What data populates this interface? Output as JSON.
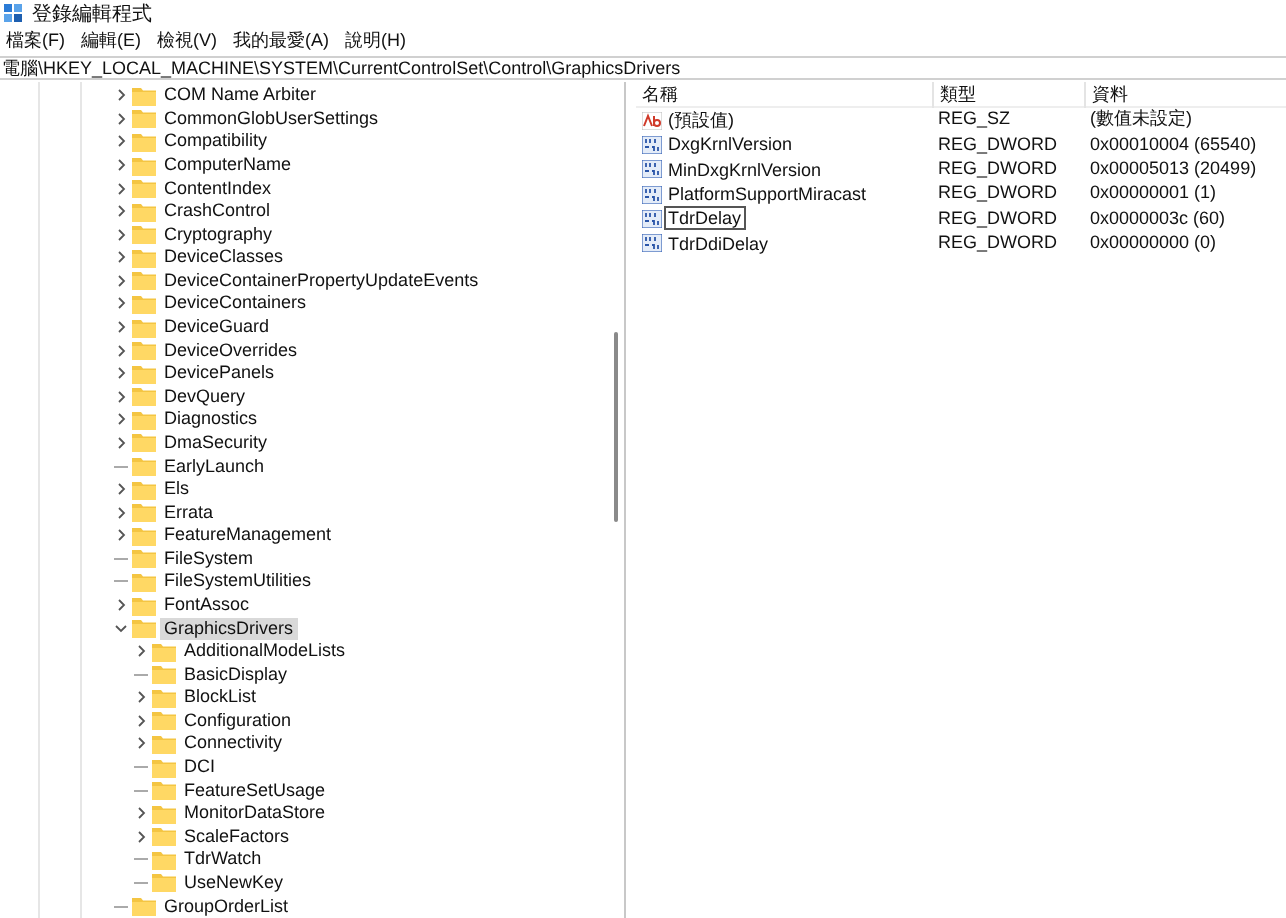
{
  "window": {
    "title": "登錄編輯程式"
  },
  "menu": [
    "檔案(F)",
    "編輯(E)",
    "檢視(V)",
    "我的最愛(A)",
    "說明(H)"
  ],
  "address": "電腦\\HKEY_LOCAL_MACHINE\\SYSTEM\\CurrentControlSet\\Control\\GraphicsDrivers",
  "tree": [
    {
      "label": "COM Name Arbiter",
      "expandable": true,
      "expanded": false,
      "selected": false
    },
    {
      "label": "CommonGlobUserSettings",
      "expandable": true,
      "expanded": false,
      "selected": false
    },
    {
      "label": "Compatibility",
      "expandable": true,
      "expanded": false,
      "selected": false
    },
    {
      "label": "ComputerName",
      "expandable": true,
      "expanded": false,
      "selected": false
    },
    {
      "label": "ContentIndex",
      "expandable": true,
      "expanded": false,
      "selected": false
    },
    {
      "label": "CrashControl",
      "expandable": true,
      "expanded": false,
      "selected": false
    },
    {
      "label": "Cryptography",
      "expandable": true,
      "expanded": false,
      "selected": false
    },
    {
      "label": "DeviceClasses",
      "expandable": true,
      "expanded": false,
      "selected": false
    },
    {
      "label": "DeviceContainerPropertyUpdateEvents",
      "expandable": true,
      "expanded": false,
      "selected": false
    },
    {
      "label": "DeviceContainers",
      "expandable": true,
      "expanded": false,
      "selected": false
    },
    {
      "label": "DeviceGuard",
      "expandable": true,
      "expanded": false,
      "selected": false
    },
    {
      "label": "DeviceOverrides",
      "expandable": true,
      "expanded": false,
      "selected": false
    },
    {
      "label": "DevicePanels",
      "expandable": true,
      "expanded": false,
      "selected": false
    },
    {
      "label": "DevQuery",
      "expandable": true,
      "expanded": false,
      "selected": false
    },
    {
      "label": "Diagnostics",
      "expandable": true,
      "expanded": false,
      "selected": false
    },
    {
      "label": "DmaSecurity",
      "expandable": true,
      "expanded": false,
      "selected": false
    },
    {
      "label": "EarlyLaunch",
      "expandable": false,
      "selected": false
    },
    {
      "label": "Els",
      "expandable": true,
      "expanded": false,
      "selected": false
    },
    {
      "label": "Errata",
      "expandable": true,
      "expanded": false,
      "selected": false
    },
    {
      "label": "FeatureManagement",
      "expandable": true,
      "expanded": false,
      "selected": false
    },
    {
      "label": "FileSystem",
      "expandable": false,
      "selected": false
    },
    {
      "label": "FileSystemUtilities",
      "expandable": false,
      "selected": false
    },
    {
      "label": "FontAssoc",
      "expandable": true,
      "expanded": false,
      "selected": false
    },
    {
      "label": "GraphicsDrivers",
      "expandable": true,
      "expanded": true,
      "selected": true,
      "children": [
        {
          "label": "AdditionalModeLists",
          "expandable": true,
          "expanded": false,
          "selected": false
        },
        {
          "label": "BasicDisplay",
          "expandable": false,
          "selected": false
        },
        {
          "label": "BlockList",
          "expandable": true,
          "expanded": false,
          "selected": false
        },
        {
          "label": "Configuration",
          "expandable": true,
          "expanded": false,
          "selected": false
        },
        {
          "label": "Connectivity",
          "expandable": true,
          "expanded": false,
          "selected": false
        },
        {
          "label": "DCI",
          "expandable": false,
          "selected": false
        },
        {
          "label": "FeatureSetUsage",
          "expandable": false,
          "selected": false
        },
        {
          "label": "MonitorDataStore",
          "expandable": true,
          "expanded": false,
          "selected": false
        },
        {
          "label": "ScaleFactors",
          "expandable": true,
          "expanded": false,
          "selected": false
        },
        {
          "label": "TdrWatch",
          "expandable": false,
          "selected": false
        },
        {
          "label": "UseNewKey",
          "expandable": false,
          "selected": false
        }
      ]
    },
    {
      "label": "GroupOrderList",
      "expandable": false,
      "selected": false
    }
  ],
  "values": {
    "columns": [
      "名稱",
      "類型",
      "資料"
    ],
    "rows": [
      {
        "kind": "string",
        "name": "(預設值)",
        "type": "REG_SZ",
        "data": "(數值未設定)",
        "focused": false
      },
      {
        "kind": "binary",
        "name": "DxgKrnlVersion",
        "type": "REG_DWORD",
        "data": "0x00010004 (65540)",
        "focused": false
      },
      {
        "kind": "binary",
        "name": "MinDxgKrnlVersion",
        "type": "REG_DWORD",
        "data": "0x00005013 (20499)",
        "focused": false
      },
      {
        "kind": "binary",
        "name": "PlatformSupportMiracast",
        "type": "REG_DWORD",
        "data": "0x00000001 (1)",
        "focused": false
      },
      {
        "kind": "binary",
        "name": "TdrDelay",
        "type": "REG_DWORD",
        "data": "0x0000003c (60)",
        "focused": true
      },
      {
        "kind": "binary",
        "name": "TdrDdiDelay",
        "type": "REG_DWORD",
        "data": "0x00000000 (0)",
        "focused": false
      }
    ]
  }
}
